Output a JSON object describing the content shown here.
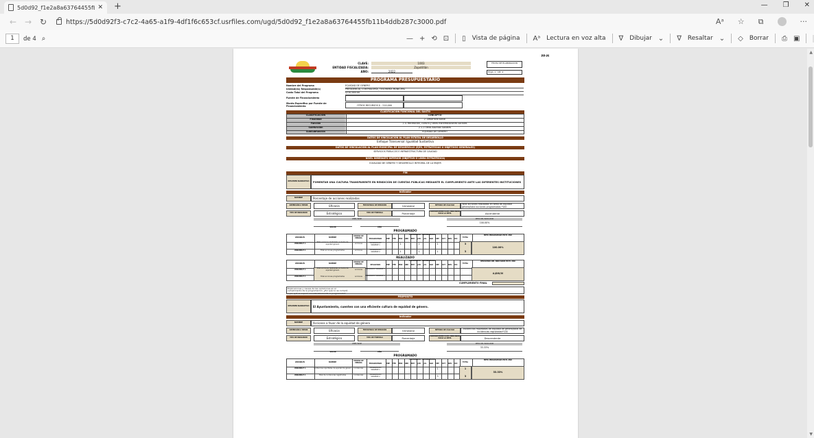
{
  "browser": {
    "tab_title": "5d0d92_f1e2a8a63764455fb11b",
    "url": "https://5d0d92f3-c7c2-4a65-a1f9-4df1f6c653cf.usrfiles.com/ugd/5d0d92_f1e2a8a63764455fb11b4ddb287c3000.pdf"
  },
  "pdf_toolbar": {
    "page_current": "1",
    "page_total": "de 4",
    "zoom_minus": "—",
    "zoom_plus": "+",
    "page_view": "Vista de página",
    "read_aloud": "Lectura en voz alta",
    "draw": "Dibujar",
    "highlight": "Resaltar",
    "erase": "Borrar"
  },
  "document": {
    "corner_code": "PP-M",
    "clave_label": "CLAVE:",
    "clave_value": "1003",
    "entidad_label": "ENTIDAD FISCALIZADA:",
    "entidad_value": "Zapotitlán",
    "anio_label": "AÑO:",
    "anio_value": "2022",
    "side_box_title": "FECHA DE ELABORACIÓN",
    "hoja_label": "HOJA: 1",
    "hoja_de": "DE: 4",
    "title": "PROGRAMA PRESUPUESTARIO",
    "fields": [
      {
        "label": "Nombre del Programa",
        "value": "EQUIDAD DE GENERO"
      },
      {
        "label": "Unidad(es) Responsable(s)",
        "value": "PRESIDENCIA, CONTRALORÍA, TESORERÍA MUNICIPAL"
      },
      {
        "label": "Costo Total del Programa",
        "value": "$210,000.00"
      },
      {
        "label": "Fuente de Financiamiento",
        "value": ""
      },
      {
        "label": "Monto Específico por Fuente de Financiamiento",
        "value": "OTROS RECURSOS $ - 210,000"
      }
    ],
    "funcional_band": "CLASIFICACIÓN FUNCIONAL DEL GASTO",
    "funcional_head": [
      "CLASIFICACIÓN",
      "CONCEPTO"
    ],
    "funcional_rows": [
      {
        "k": "Finalidad",
        "v": "2. Desarrollo social"
      },
      {
        "k": "Función",
        "v": "2.4. Recreación, cultura y otras manifestaciones sociales"
      },
      {
        "k": "Subfunción",
        "v": "2.1.1 Otros Asuntos Sociales"
      },
      {
        "k": "SubSubfunción",
        "v": "EQUIDAD DE GENERO"
      }
    ],
    "pe_band": "DATOS DE VINCULACIÓN AL PLAN ESTATAL DE DESARROLLO",
    "pe_value": "Enfoque Transversal: Igualdad Sustantiva",
    "pm_band": "DATOS DE VINCULACIÓN AL PLAN MUNICIPAL DE DESARROLLO (EJES, ESTRATEGIAS U OBJETIVOS GENERALES)",
    "pm_value": "SERVICIOS PÚBLICOS E INFRAESTRUCTURA DE CALIDAD",
    "ni_band": "NIVEL INMEDIATO INFERIOR (OBJETIVO O LÍNEA ESTRATÉGICA)",
    "ni_value": "IGUALDAD DE GÉNERO Y DESARROLLO INTEGRAL DE LA MUJER",
    "fin_band": "FIN",
    "fin_label": "RESUMEN NARRATIVO",
    "fin_text": "FOMENTAR UNA CULTURA TRANSPARENTE EN RENDICIÓN DE CUENTAS PÚBLICAS MEDIANTE EL CUMPLIMIENTO ANTE LAS DIFERENTES INSTITUCIONES",
    "indicador_band": "Indicador",
    "ind1": {
      "nombre_label": "NOMBRE",
      "nombre": "Porcentaje de acciones realizadas",
      "dimension_label": "DIMENSIÓN A MEDIR",
      "dimension": "Eficacia",
      "frecuencia_label": "FRECUENCIA DE MEDICIÓN",
      "frecuencia": "trimestral",
      "metodo_label": "MÉTODO DE CÁLCULO",
      "metodo": "Total acciones realizadas en tema de equidad género/total acciones programadas *100",
      "tipo_label": "TIPO DE INDICADOR",
      "tipo": "Estratégico",
      "formula_label": "TIPO DE FÓRMULA",
      "formula": "Porcentaje",
      "comportamiento_label": "COMPORTAMIENTO DEL INDICADOR HACIA LA META",
      "comportamiento": "Ascendente",
      "linea_base": "LÍNEA BASE",
      "meta_label": "META DEL INDICADOR",
      "meta": "100.00%",
      "valor": "VALOR",
      "anio": "AÑO"
    },
    "programado_title": "PROGRAMADO",
    "realizado_title": "REALIZADO",
    "table_head": [
      "VARIABLES",
      "NOMBRE",
      "UNIDAD DE MEDIDA",
      "PROGRAMADO",
      "TOTAL",
      "META PROGRAMADA EN EL AÑO"
    ],
    "table_head_real": [
      "VARIABLES",
      "NOMBRE",
      "UNIDAD DE MEDIDA",
      "REALIZADO",
      "TOTAL",
      "RESULTADO DEL INDICADOR EN EL AÑO"
    ],
    "months_label": "CALENDARIO / PROGRAMADO",
    "months": [
      "ENE",
      "FEB",
      "MAR",
      "ABR",
      "MAY",
      "JUN",
      "JUL",
      "AGO",
      "SEP",
      "OCT",
      "NOV",
      "DIC"
    ],
    "prog1_rows": [
      {
        "var": "VARIABLE 1",
        "nombre": "Total acciones realizadas en tema de equidad género",
        "unidad": "acciones",
        "tipo": "PROGRAMADO VARIABLE 1",
        "marks": [
          "",
          "",
          "1",
          "",
          "",
          "1",
          "",
          "",
          "1",
          "",
          "",
          ""
        ],
        "total": "3"
      },
      {
        "var": "VARIABLE 2",
        "nombre": "Total acciones programadas",
        "unidad": "acciones",
        "tipo": "PROGRAMADO VARIABLE 2",
        "marks": [
          "",
          "",
          "1",
          "",
          "",
          "1",
          "",
          "",
          "1",
          "",
          "",
          ""
        ],
        "total": "3"
      }
    ],
    "prog1_meta": "100.00%",
    "real1_rows": [
      {
        "var": "VARIABLE 1",
        "nombre": "Total acciones realizadas en tema de equidad género",
        "unidad": "acciones",
        "tipo": "REALIZADO VARIABLE 1"
      },
      {
        "var": "VARIABLE 2",
        "nombre": "Total acciones programadas",
        "unidad": "acciones",
        "tipo": "REALIZADO VARIABLE 2"
      }
    ],
    "real1_result": "#¡DIV/0!",
    "cumplimiento": "CUMPLIMIENTO FINAL",
    "explicacion": "Explicaciones y causas de las variaciones en el cumplimiento de la programación, ¿Por qué no se cumplió o por qué se superó considerablemente lo programado?",
    "proposito_band": "PROPÓSITO",
    "proposito_label": "RESUMEN NARRATIVO",
    "proposito_text": "El Ayuntamiento, cuenten con una eficiente cultura de equidad de género.",
    "ind2": {
      "nombre_label": "NOMBRE",
      "nombre": "Acciones a favor de la equidad de género",
      "dimension_label": "DIMENSIÓN A MEDIR",
      "dimension": "Eficacia",
      "frecuencia_label": "FRECUENCIA DE MEDICIÓN",
      "frecuencia": "trimestral",
      "metodo_label": "MÉTODO DE CÁLCULO",
      "metodo": "Incidencias reportadas de equidad de género/total de incidencias registradas*100",
      "tipo_label": "TIPO DE INDICADOR",
      "tipo": "Estratégico",
      "formula_label": "TIPO DE FÓRMULA",
      "formula": "Porcentaje",
      "comportamiento_label": "COMPORTAMIENTO DEL INDICADOR HACIA LA META",
      "comportamiento": "Descendente",
      "linea_base": "LÍNEA BASE",
      "meta_label": "META DEL INDICADOR",
      "meta": "33.33%",
      "valor": "VALOR",
      "anio": "AÑO"
    },
    "prog2_rows": [
      {
        "var": "VARIABLE 1",
        "nombre": "Incidencias reportadas de equidad de género",
        "unidad": "incidencias",
        "tipo": "PROGRAMADO VARIABLE 1",
        "marks": [
          "",
          "",
          "",
          "",
          "",
          "",
          "",
          "",
          "1",
          "",
          "",
          ""
        ],
        "total": "1"
      },
      {
        "var": "VARIABLE 2",
        "nombre": "Total de incidencias registradas",
        "unidad": "incidencias",
        "tipo": "PROGRAMADO VARIABLE 2",
        "marks": [
          "",
          "",
          "",
          "",
          "",
          "",
          "",
          "",
          "3",
          "",
          "",
          ""
        ],
        "total": "3"
      }
    ],
    "prog2_meta": "33.33%"
  }
}
